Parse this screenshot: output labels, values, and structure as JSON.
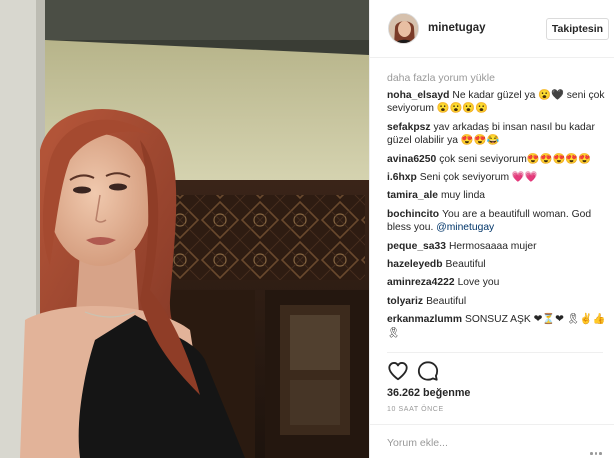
{
  "post": {
    "image_alt": "Selfie of a woman with auburn hair in a black top in front of a carved wooden door",
    "author": {
      "username": "minetugay"
    },
    "follow_label": "Takiptesin",
    "load_more_label": "daha fazla yorum yükle",
    "comments": [
      {
        "user": "noha_elsayd",
        "text": "Ne kadar güzel ya 😮🖤 seni çok seviyorum 😮😮😮😮"
      },
      {
        "user": "sefakpsz",
        "text": "yav arkadaş bi insan nasıl bu kadar güzel olabilir ya 😍😍😂"
      },
      {
        "user": "avina6250",
        "text": "çok seni seviyorum😍😍😍😍😍"
      },
      {
        "user": "i.6hxp",
        "text": "Seni çok seviyorum 💗💗"
      },
      {
        "user": "tamira_ale",
        "text": "muy linda"
      },
      {
        "user": "bochincito",
        "text": "You are a beautifull woman. God bless you.",
        "mention": "@minetugay"
      },
      {
        "user": "peque_sa33",
        "text": "Hermosaaaa mujer"
      },
      {
        "user": "hazeleyedb",
        "text": "Beautiful"
      },
      {
        "user": "aminreza4222",
        "text": "Love you"
      },
      {
        "user": "tolyariz",
        "text": "Beautiful"
      },
      {
        "user": "erkanmazlumm",
        "text": "SONSUZ AŞK ❤⏳❤ 🎗✌👍 🎗"
      }
    ],
    "likes_label": "36.262 beğenme",
    "time_label": "10 SAAT ÖNCE",
    "add_comment_placeholder": "Yorum ekle...",
    "icons": {
      "like": "heart-icon",
      "comment": "comment-bubble-icon",
      "more": "more-options-icon"
    },
    "colors": {
      "username_text": "#262626",
      "secondary_text": "#999999",
      "mention": "#003569",
      "border": "#efefef"
    }
  }
}
